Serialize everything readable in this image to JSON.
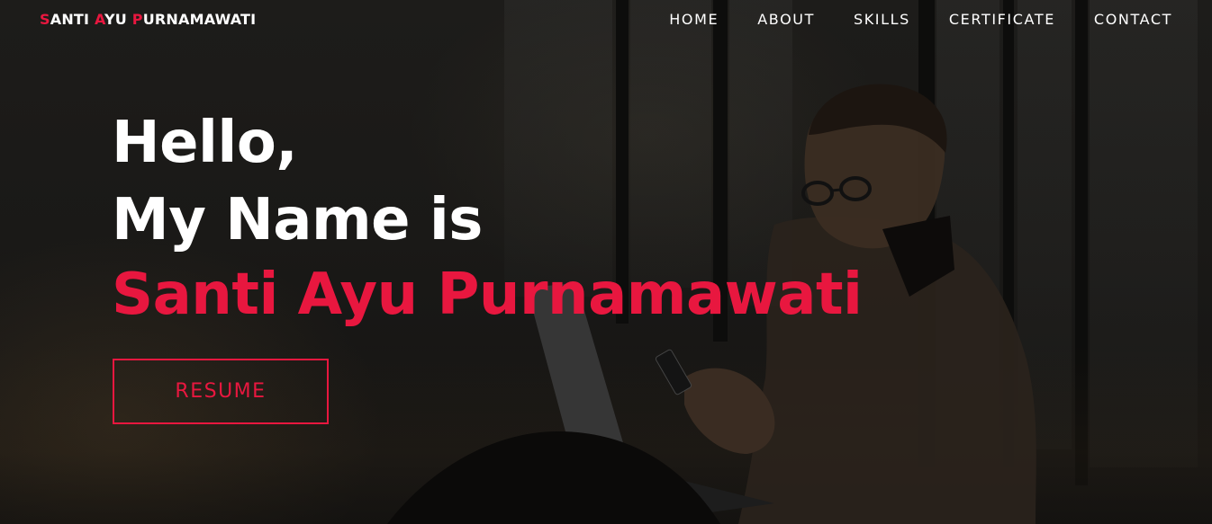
{
  "navbar": {
    "brand": {
      "part1_initial": "S",
      "part1_rest": "ANTI ",
      "part2_initial": "A",
      "part2_rest": "YU ",
      "part3_initial": "P",
      "part3_rest": "URNAMAWATI"
    },
    "links": [
      "HOME",
      "ABOUT",
      "SKILLS",
      "CERTIFICATE",
      "CONTACT"
    ]
  },
  "hero": {
    "line1": "Hello,",
    "line2": "My Name is",
    "name": "Santi Ayu Purnamawati",
    "button_label": "RESUME"
  },
  "colors": {
    "accent": "#e8173f",
    "text": "#ffffff",
    "background": "#1a1917"
  },
  "icons": {
    "background_image": "man-with-laptop-and-phone-silhouette"
  }
}
